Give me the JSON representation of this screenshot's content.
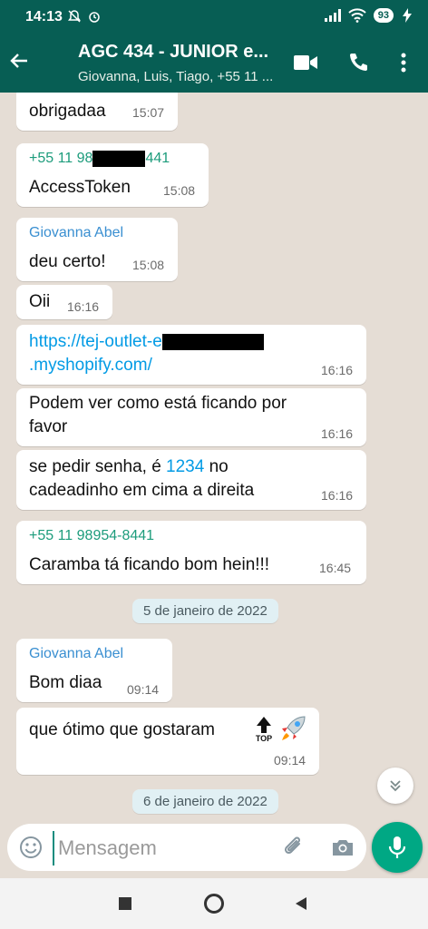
{
  "status": {
    "time": "14:13",
    "battery": "93"
  },
  "header": {
    "title": "AGC 434 - JUNIOR e...",
    "subtitle": "Giovanna, Luis, Tiago, +55 11 ..."
  },
  "messages": [
    {
      "text": "obrigadaa",
      "time": "15:07"
    },
    {
      "sender_prefix": "+55 11 98",
      "sender_suffix": "441",
      "text": "AccessToken",
      "time": "15:08"
    },
    {
      "sender": "Giovanna Abel",
      "text": "deu certo!",
      "time": "15:08"
    },
    {
      "text": "Oii",
      "time": "16:16"
    },
    {
      "link_part1": "https://tej-outlet-e",
      "link_part2": ".myshopify.com/",
      "time": "16:16"
    },
    {
      "line1": "Podem ver como está ficando por",
      "line2": "favor",
      "time": "16:16"
    },
    {
      "line1_pre": "se pedir senha, é ",
      "line1_num": "1234",
      "line1_post": " no",
      "line2": "cadeadinho em cima a direita",
      "time": "16:16"
    },
    {
      "sender": "+55 11 98954-8441",
      "text": "Caramba tá ficando bom hein!!!",
      "time": "16:45"
    },
    {
      "sender": "Giovanna Abel",
      "text": "Bom diaa",
      "time": "09:14"
    },
    {
      "text": "que ótimo que gostaram",
      "emoji_top": "TOP",
      "time": "09:14"
    }
  ],
  "dates": [
    "5 de janeiro de 2022",
    "6 de janeiro de 2022"
  ],
  "composer": {
    "placeholder": "Mensagem"
  },
  "colors": {
    "header": "#075e54",
    "sender_green": "#1d9c7c",
    "sender_blue": "#3a8fd1",
    "link": "#039be5",
    "mic": "#00a884",
    "wallpaper": "#e5ddd5"
  },
  "icons": {
    "back": "arrow-left-icon",
    "video": "video-call-icon",
    "call": "phone-icon",
    "menu": "more-vert-icon",
    "emoji": "emoji-icon",
    "attach": "paperclip-icon",
    "camera": "camera-icon",
    "mic": "microphone-icon",
    "scroll": "chevron-double-down-icon"
  }
}
